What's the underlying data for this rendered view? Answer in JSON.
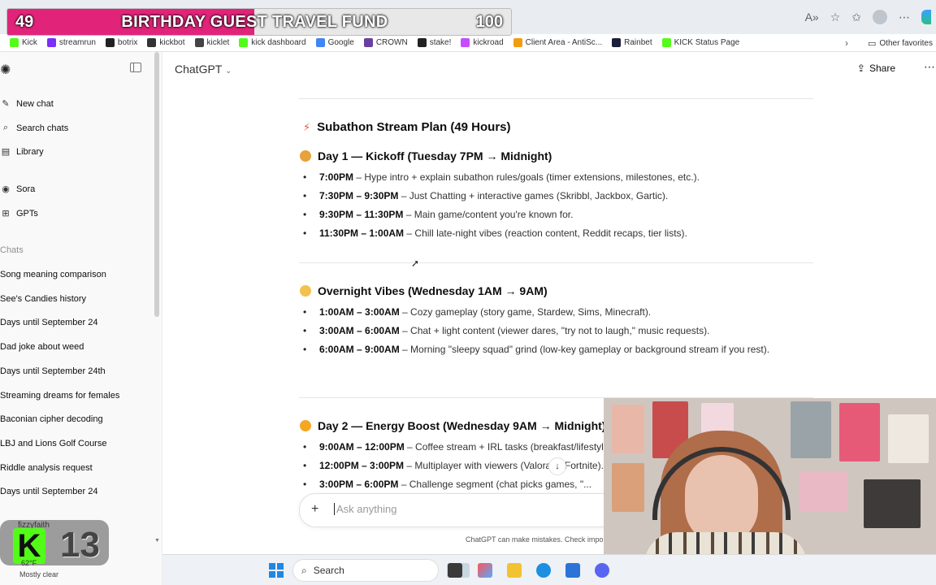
{
  "overlay": {
    "fund_current": "49",
    "fund_title": "BIRTHDAY GUEST TRAVEL FUND",
    "fund_goal": "100",
    "fund_progress": 0.49
  },
  "bookmarks": [
    {
      "label": "Kick",
      "color": "#53fc18"
    },
    {
      "label": "streamrun",
      "color": "#7b2ff7"
    },
    {
      "label": "botrix",
      "color": "#222222"
    },
    {
      "label": "kickbot",
      "color": "#333333"
    },
    {
      "label": "kicklet",
      "color": "#444444"
    },
    {
      "label": "kick dashboard",
      "color": "#53fc18"
    },
    {
      "label": "Google",
      "color": "#4285f4"
    },
    {
      "label": "CROWN",
      "color": "#6b3fa0"
    },
    {
      "label": "stake!",
      "color": "#222222"
    },
    {
      "label": "kickroad",
      "color": "#c44dff"
    },
    {
      "label": "Client Area - AntiSc...",
      "color": "#f39c12"
    },
    {
      "label": "Rainbet",
      "color": "#1b1f3b"
    },
    {
      "label": "KICK Status Page",
      "color": "#53fc18"
    }
  ],
  "bookmarks_other": "Other favorites",
  "sidebar": {
    "nav": [
      {
        "label": "New chat",
        "icon": "✎"
      },
      {
        "label": "Search chats",
        "icon": "⌕"
      },
      {
        "label": "Library",
        "icon": "▤"
      },
      {
        "label": "Sora",
        "icon": "◉"
      },
      {
        "label": "GPTs",
        "icon": "⊞"
      }
    ],
    "chats_heading": "Chats",
    "chats": [
      "Song meaning comparison",
      "See's Candies history",
      "Days until September 24",
      "Dad joke about weed",
      "Days until September 24th",
      "Streaming dreams for females",
      "Baconian cipher decoding",
      "LBJ and Lions Golf Course",
      "Riddle analysis request",
      "Days until September 24"
    ]
  },
  "kick_overlay": {
    "username": "fizzyfaith",
    "letter": "K",
    "count": "13",
    "temp": "62°F",
    "weather": "Mostly clear"
  },
  "header": {
    "model": "ChatGPT",
    "share": "Share"
  },
  "content": {
    "title": "Subathon Stream Plan (49 Hours)",
    "title_icon": "⚡",
    "sections": [
      {
        "heading": "Day 1 — Kickoff (Tuesday 7PM → Midnight)",
        "icon_color": "#e8a23a",
        "items": [
          {
            "time": "7:00PM",
            "text": " – Hype intro + explain subathon rules/goals (timer extensions, milestones, etc.)."
          },
          {
            "time": "7:30PM – 9:30PM",
            "text": " – Just Chatting + interactive games (Skribbl, Jackbox, Gartic)."
          },
          {
            "time": "9:30PM – 11:30PM",
            "text": " – Main game/content you're known for."
          },
          {
            "time": "11:30PM – 1:00AM",
            "text": " – Chill late-night vibes (reaction content, Reddit recaps, tier lists)."
          }
        ]
      },
      {
        "heading": "Overnight Vibes (Wednesday 1AM → 9AM)",
        "icon_color": "#f2c14e",
        "items": [
          {
            "time": "1:00AM – 3:00AM",
            "text": " – Cozy gameplay (story game, Stardew, Sims, Minecraft)."
          },
          {
            "time": "3:00AM – 6:00AM",
            "text": " – Chat + light content (viewer dares, \"try not to laugh,\" music requests)."
          },
          {
            "time": "6:00AM – 9:00AM",
            "text": " – Morning \"sleepy squad\" grind (low-key gameplay or background stream if you rest)."
          }
        ]
      },
      {
        "heading": "Day 2 — Energy Boost (Wednesday 9AM → Midnight)",
        "icon_color": "#f5a623",
        "items": [
          {
            "time": "9:00AM – 12:00PM",
            "text": " – Coffee stream + IRL tasks (breakfast/lifestyle)."
          },
          {
            "time": "12:00PM – 3:00PM",
            "text": " – Multiplayer with viewers (Valorant, Fortnite)."
          },
          {
            "time": "3:00PM – 6:00PM",
            "text": " – Challenge segment (chat picks games, \"..."
          }
        ]
      }
    ]
  },
  "composer": {
    "placeholder": "Ask anything"
  },
  "disclaimer": "ChatGPT can make mistakes. Check important info.",
  "taskbar": {
    "search_label": "Search"
  }
}
